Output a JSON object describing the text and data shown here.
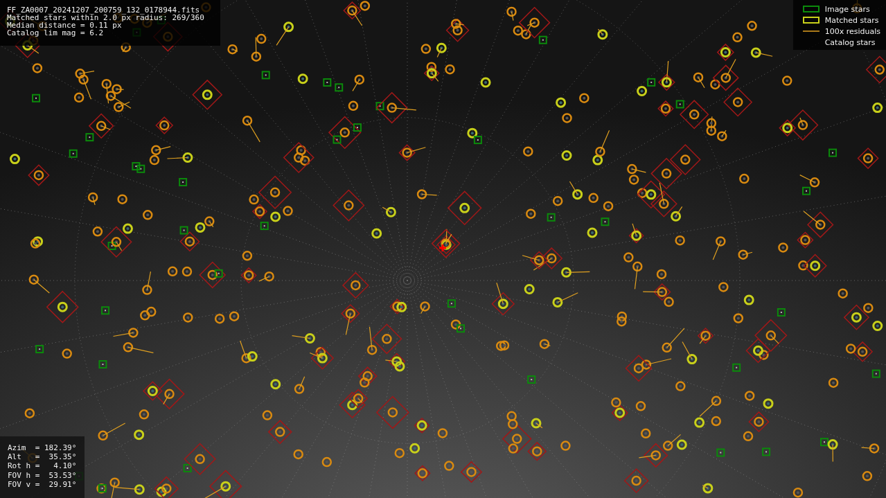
{
  "info_box": {
    "lines": [
      "FF_ZA0007_20241207_200759_132_0178944.fits",
      "Matched stars within 2.0 px radius: 269/360",
      "Median distance = 0.11 px",
      "Catalog lim mag = 6.2"
    ]
  },
  "legend": {
    "items": [
      {
        "kind": "image",
        "label": "Image stars"
      },
      {
        "kind": "matched",
        "label": "Matched stars"
      },
      {
        "kind": "residual",
        "label": "100x residuals"
      },
      {
        "kind": "catalog",
        "label": "Catalog stars"
      }
    ]
  },
  "pointing_box": {
    "lines": [
      "Azim  = 182.39°",
      "Alt   =  35.35°",
      "Rot h =   4.10°",
      "FOV h =  53.53°",
      "FOV v =  29.91°"
    ]
  }
}
